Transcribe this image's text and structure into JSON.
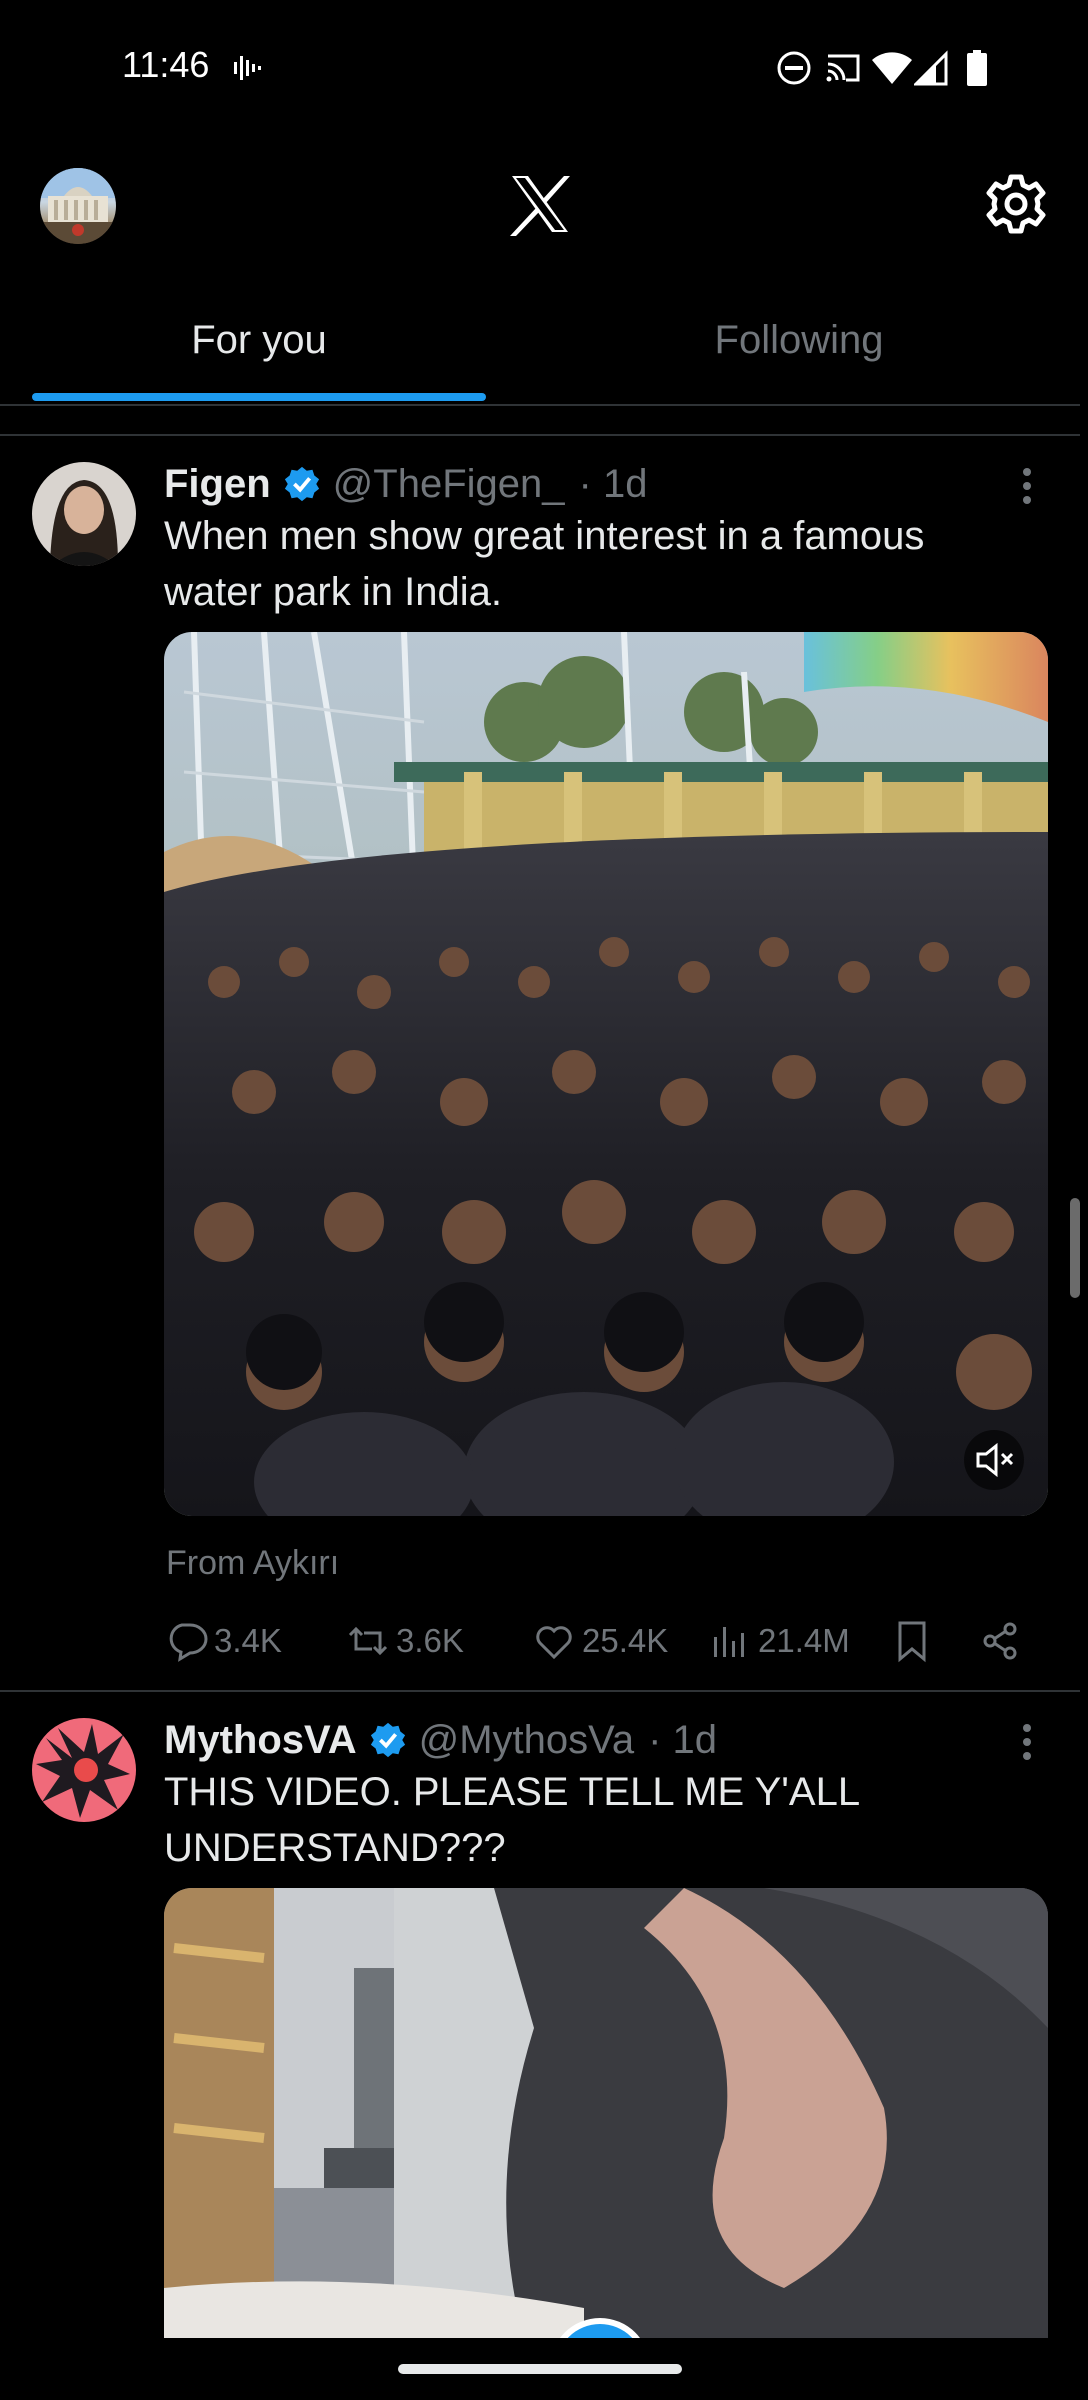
{
  "status_bar": {
    "time": "11:46",
    "icons": [
      "voicemail-icon",
      "dnd-icon",
      "cast-icon",
      "wifi-icon",
      "signal-icon",
      "battery-icon"
    ]
  },
  "header": {
    "logo": "X",
    "icons": [
      "profile-avatar",
      "x-logo-icon",
      "gear-icon"
    ]
  },
  "tabs": [
    {
      "label": "For you",
      "selected": true
    },
    {
      "label": "Following",
      "selected": false
    }
  ],
  "tweets": [
    {
      "name": "Figen",
      "handle": "@TheFigen_",
      "time": "· 1d",
      "text": "When men show great interest in a famous water park in India.",
      "from": "From Aykırı",
      "stats": {
        "replies": "3.4K",
        "reposts": "3.6K",
        "likes": "25.4K",
        "views": "21.4M"
      }
    },
    {
      "name": "MythosVA",
      "handle": "@MythosVa",
      "time": "· 1d",
      "text": "THIS VIDEO. PLEASE TELL ME Y'ALL UNDERSTAND???"
    }
  ],
  "colors": {
    "accent": "#1d9bf0",
    "background": "#000000",
    "secondary_text": "#71767b"
  }
}
